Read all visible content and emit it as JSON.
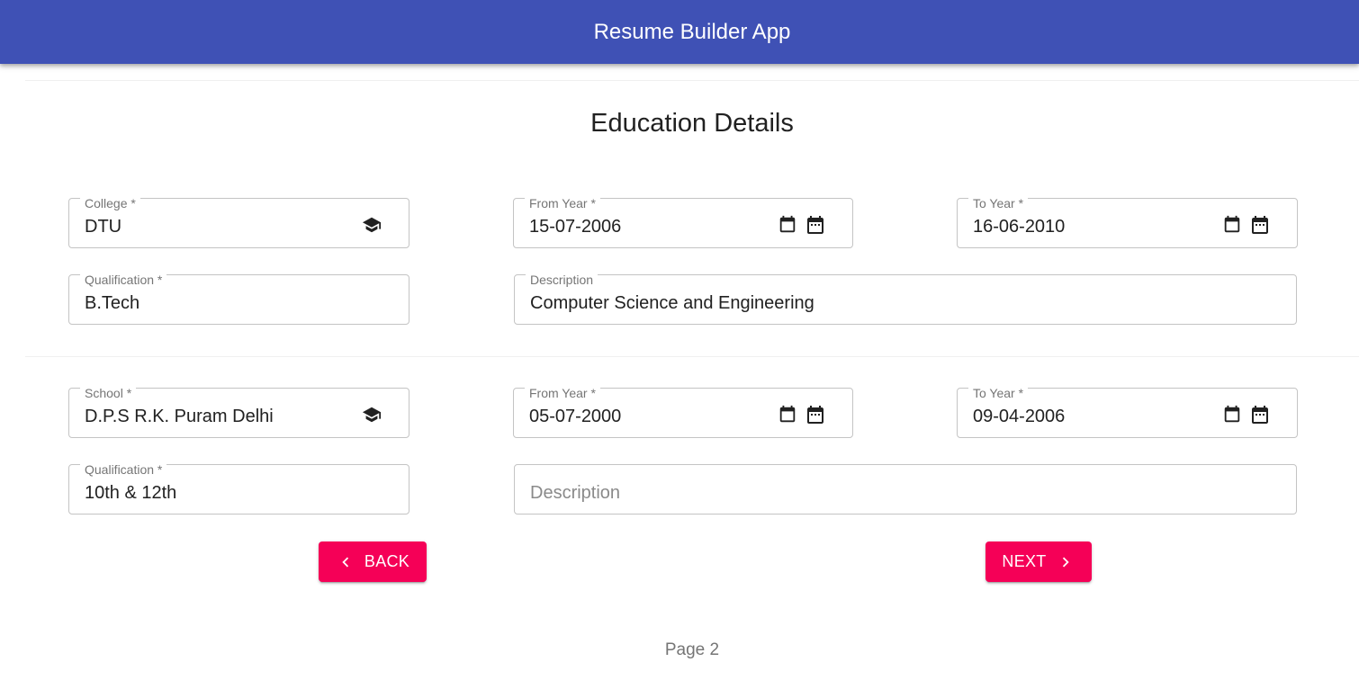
{
  "app": {
    "title": "Resume Builder App"
  },
  "page": {
    "title": "Education Details",
    "footer": "Page 2"
  },
  "college": {
    "name_label": "College *",
    "name_value": "DTU",
    "from_label": "From Year *",
    "from_value": "15-07-2006",
    "to_label": "To Year *",
    "to_value": "16-06-2010",
    "qualification_label": "Qualification *",
    "qualification_value": "B.Tech",
    "description_label": "Description",
    "description_value": "Computer Science and Engineering"
  },
  "school": {
    "name_label": "School *",
    "name_value": "D.P.S R.K. Puram Delhi",
    "from_label": "From Year *",
    "from_value": "05-07-2000",
    "to_label": "To Year *",
    "to_value": "09-04-2006",
    "qualification_label": "Qualification *",
    "qualification_value": "10th & 12th",
    "description_placeholder": "Description"
  },
  "buttons": {
    "back_label": "BACK",
    "next_label": "NEXT"
  },
  "icons": {
    "institution": "graduation-cap-icon",
    "date": "calendar-icon",
    "back": "chevron-left-icon",
    "next": "chevron-right-icon"
  },
  "colors": {
    "appbar": "#3f51b5",
    "accent": "#f50057"
  }
}
